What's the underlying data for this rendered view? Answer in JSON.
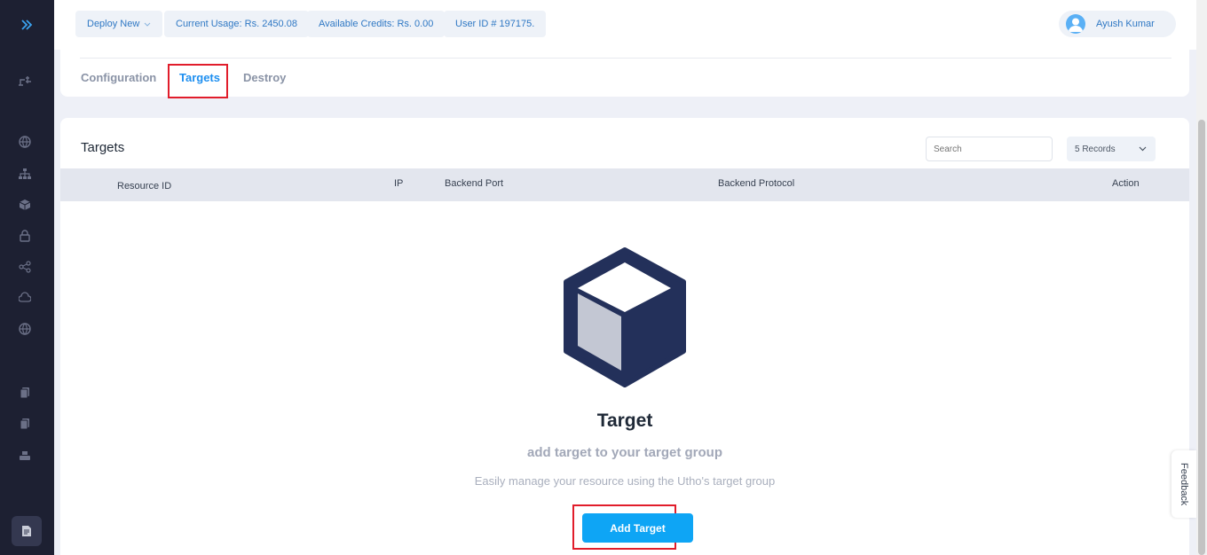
{
  "topbar": {
    "deploy_label": "Deploy New",
    "usage_label": "Current Usage: Rs. 2450.08",
    "credits_label": "Available Credits: Rs. 0.00",
    "userid_label": "User ID # 197175.",
    "user_name": "Ayush Kumar"
  },
  "tabs": [
    {
      "label": "Configuration",
      "active": false
    },
    {
      "label": "Targets",
      "active": true
    },
    {
      "label": "Destroy",
      "active": false
    }
  ],
  "targets_card": {
    "title": "Targets",
    "search_placeholder": "Search",
    "records_label": "5 Records",
    "columns": [
      "Resource ID",
      "IP",
      "Backend Port",
      "Backend Protocol",
      "Action"
    ],
    "rows": []
  },
  "empty_state": {
    "title": "Target",
    "subtitle": "add target to your target group",
    "description": "Easily manage your resource using the Utho's target group",
    "button_label": "Add Target"
  },
  "feedback_label": "Feedback",
  "colors": {
    "sidebar": "#1d2032",
    "accent": "#0ea5f5",
    "active_tab": "#1e8ff0",
    "highlight_box": "#e11d2b",
    "cube_dark": "#23305a"
  },
  "sidebar_icons": [
    "expand-icon",
    "deploy-icon",
    "globe-icon",
    "network-icon",
    "cube-icon",
    "lock-icon",
    "share-icon",
    "cloud-icon",
    "dns-icon",
    "copy-icon",
    "files-icon",
    "server-icon",
    "document-icon"
  ]
}
